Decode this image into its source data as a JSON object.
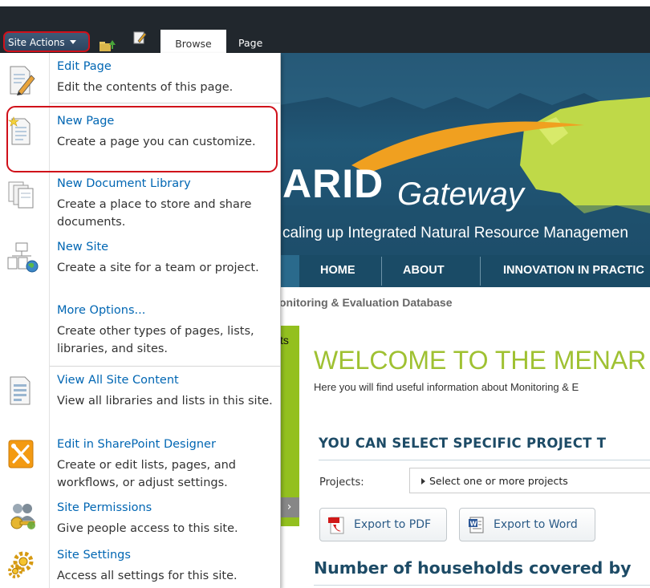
{
  "ribbon": {
    "site_actions": "Site Actions",
    "tabs": [
      "Browse",
      "Page"
    ]
  },
  "banner": {
    "title_part1": "ARID",
    "title_part2": "Gateway",
    "subtitle": "caling up Integrated Natural Resource Managemen"
  },
  "nav": {
    "items": [
      "HOME",
      "ABOUT",
      "INNOVATION IN PRACTIC"
    ]
  },
  "breadcrumb": "onitoring & Evaluation Database",
  "sidebar_tab_text": "ts",
  "main": {
    "welcome": "WELCOME TO THE MENAR",
    "welcome_sub": "Here you will find useful information about Monitoring & E",
    "select_heading": "YOU CAN SELECT SPECIFIC PROJECT T",
    "projects_label": "Projects:",
    "projects_placeholder": "Select one or more projects",
    "export_pdf": "Export to PDF",
    "export_word": "Export to Word",
    "households_heading": "Number of households covered by"
  },
  "menu": {
    "items": [
      {
        "title": "Edit Page",
        "desc": "Edit the contents of this page.",
        "icon": "edit-page-icon"
      },
      {
        "title": "New Page",
        "desc": "Create a page you can customize.",
        "icon": "new-page-icon"
      },
      {
        "title": "New Document Library",
        "desc": "Create a place to store and share documents.",
        "icon": "document-library-icon"
      },
      {
        "title": "New Site",
        "desc": "Create a site for a team or project.",
        "icon": "new-site-icon"
      },
      {
        "title": "More Options...",
        "desc": "Create other types of pages, lists, libraries, and sites.",
        "icon": ""
      },
      {
        "title": "View All Site Content",
        "desc": "View all libraries and lists in this site.",
        "icon": "site-content-icon"
      },
      {
        "title": "Edit in SharePoint Designer",
        "desc": "Create or edit lists, pages, and workflows, or adjust settings.",
        "icon": "sharepoint-designer-icon"
      },
      {
        "title": "Site Permissions",
        "desc": "Give people access to this site.",
        "icon": "site-permissions-icon"
      },
      {
        "title": "Site Settings",
        "desc": "Access all settings for this site.",
        "icon": "site-settings-icon"
      }
    ]
  },
  "colors": {
    "ribbon_dark": "#21272d",
    "link_blue": "#0066b3",
    "highlight_red": "#d0101a",
    "nav_blue": "#1a4b66",
    "accent_green": "#93c01f",
    "welcome_green": "#9fc132"
  }
}
